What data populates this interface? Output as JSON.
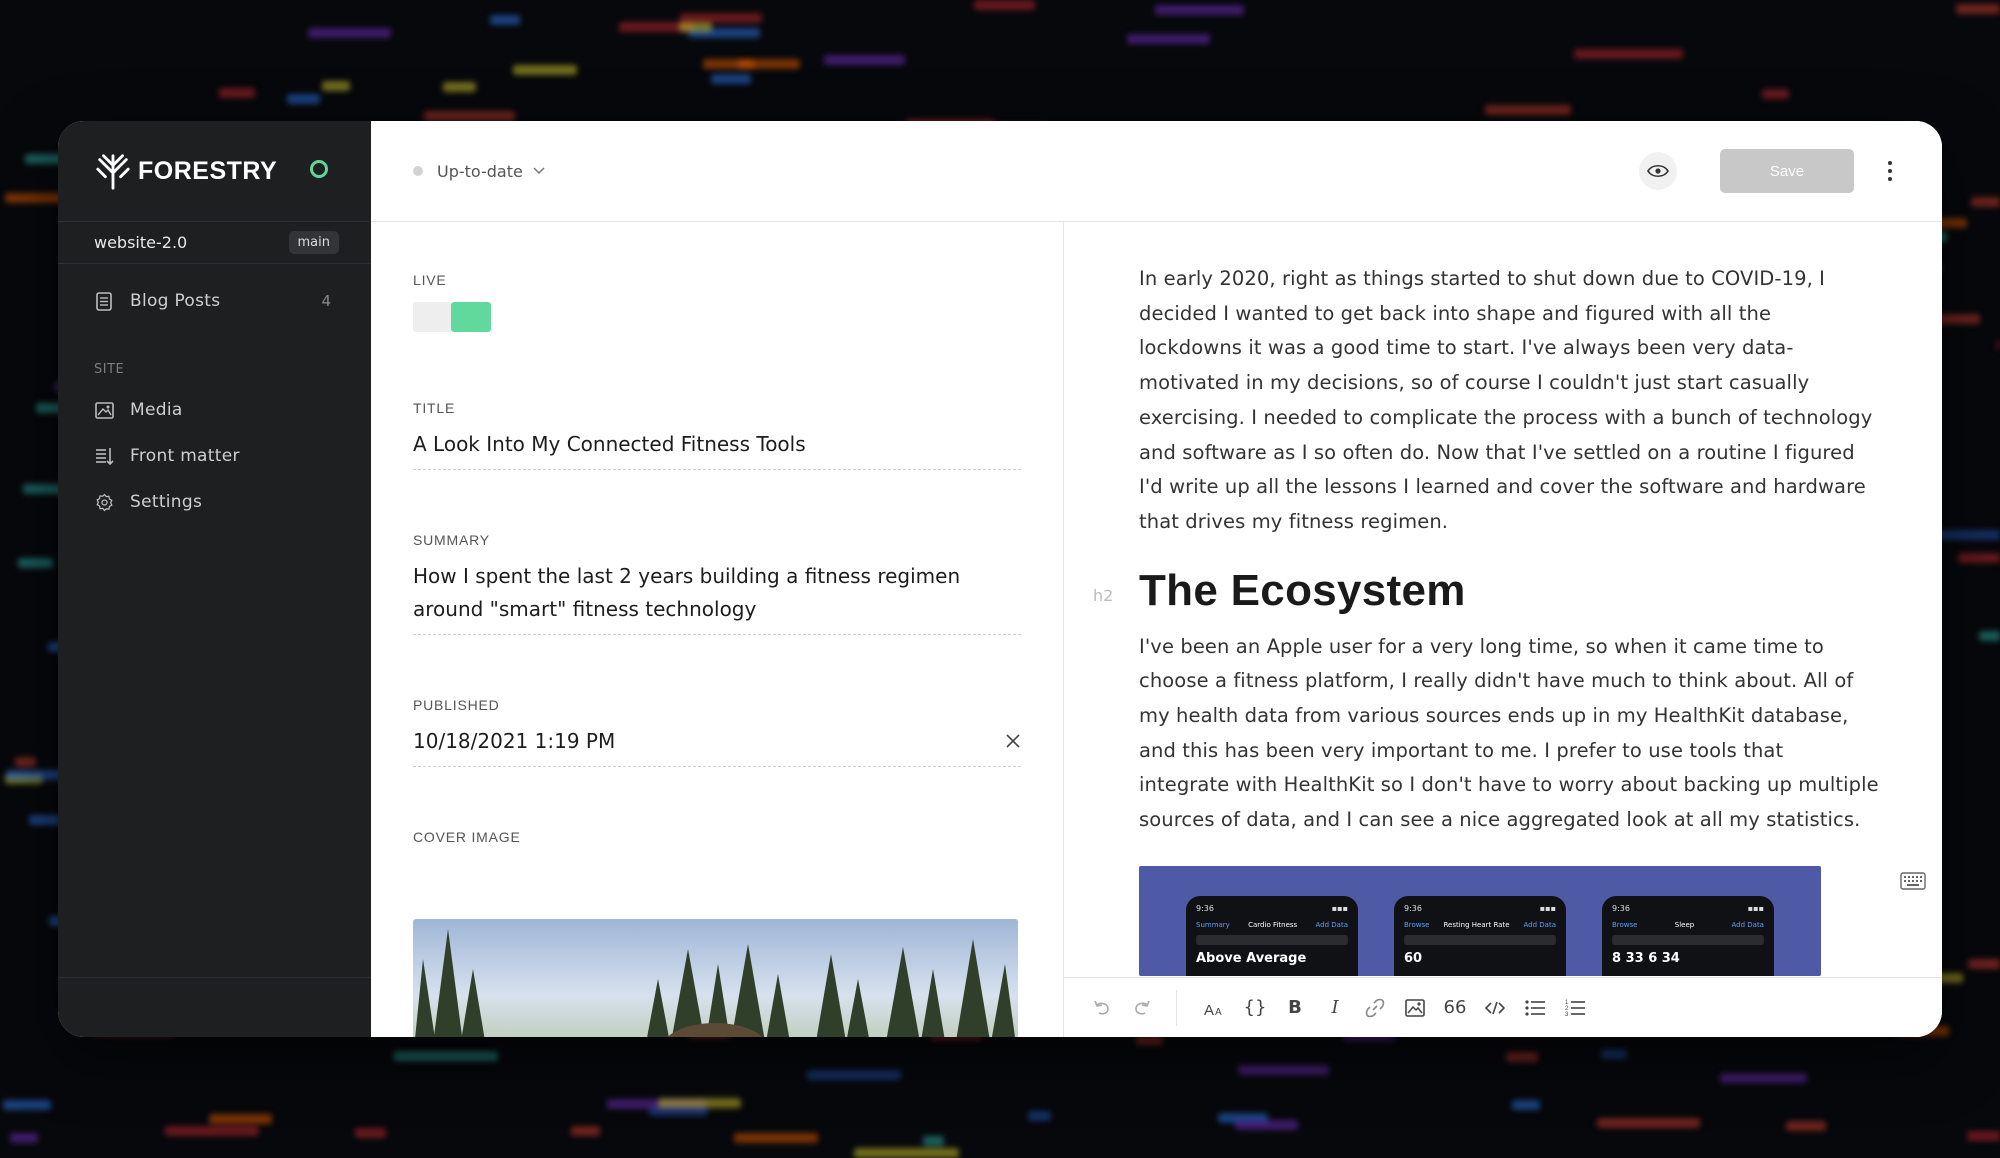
{
  "brand": {
    "name": "FORESTRY",
    "status_color": "#5fd59a"
  },
  "repo": {
    "name": "website-2.0",
    "branch": "main"
  },
  "sidebar": {
    "content_items": [
      {
        "label": "Blog Posts",
        "count": "4",
        "icon": "document-icon"
      }
    ],
    "site_section_title": "SITE",
    "site_items": [
      {
        "label": "Media",
        "icon": "image-icon"
      },
      {
        "label": "Front matter",
        "icon": "front-matter-icon"
      },
      {
        "label": "Settings",
        "icon": "gear-icon"
      }
    ]
  },
  "topbar": {
    "status": "Up-to-date",
    "save_label": "Save"
  },
  "fields": {
    "live": {
      "label": "LIVE",
      "on": true,
      "accent": "#62d99c"
    },
    "title": {
      "label": "TITLE",
      "value": "A Look Into My Connected Fitness Tools"
    },
    "summary": {
      "label": "SUMMARY",
      "value": "How I spent the last 2 years building a fitness regimen around \"smart\" fitness technology"
    },
    "published": {
      "label": "PUBLISHED",
      "value": "10/18/2021 1:19 PM"
    },
    "cover_image": {
      "label": "COVER IMAGE"
    }
  },
  "editor": {
    "paragraph1": "In early 2020, right as things started to shut down due to COVID-19, I decided I wanted to get back into shape and figured with all the lockdowns it was a good time to start. I've always been very data-motivated in my decisions, so of course I couldn't just start casually exercising. I needed to complicate the process with a bunch of technology and software as I so often do. Now that I've settled on a routine I figured I'd write up all the lessons I learned and cover the software and hardware that drives my fitness regimen.",
    "heading_tag": "h2",
    "heading": "The Ecosystem",
    "paragraph2": "I've been an Apple user for a very long time, so when it came time to choose a fitness platform, I really didn't have much to think about. All of my health data from various sources ends up in my HealthKit database, and this has been very important to me. I prefer to use tools that integrate with HealthKit so I don't have to worry about backing up multiple sources of data, and I can see a nice aggregated look at all my statistics.",
    "screens": [
      {
        "time": "9:36",
        "back": "Summary",
        "title": "Cardio Fitness",
        "action": "Add Data",
        "value": "Above Average"
      },
      {
        "time": "9:36",
        "back": "Browse",
        "title": "Resting Heart Rate",
        "action": "Add Data",
        "value": "60"
      },
      {
        "time": "9:36",
        "back": "Browse",
        "title": "Sleep",
        "action": "Add Data",
        "value": "8 33   6 34"
      }
    ]
  },
  "toolbar": {
    "undo": "undo-icon",
    "redo": "redo-icon",
    "text_size": "text-size-icon",
    "code_block": "{}",
    "bold": "B",
    "italic": "I",
    "quote": "66"
  }
}
